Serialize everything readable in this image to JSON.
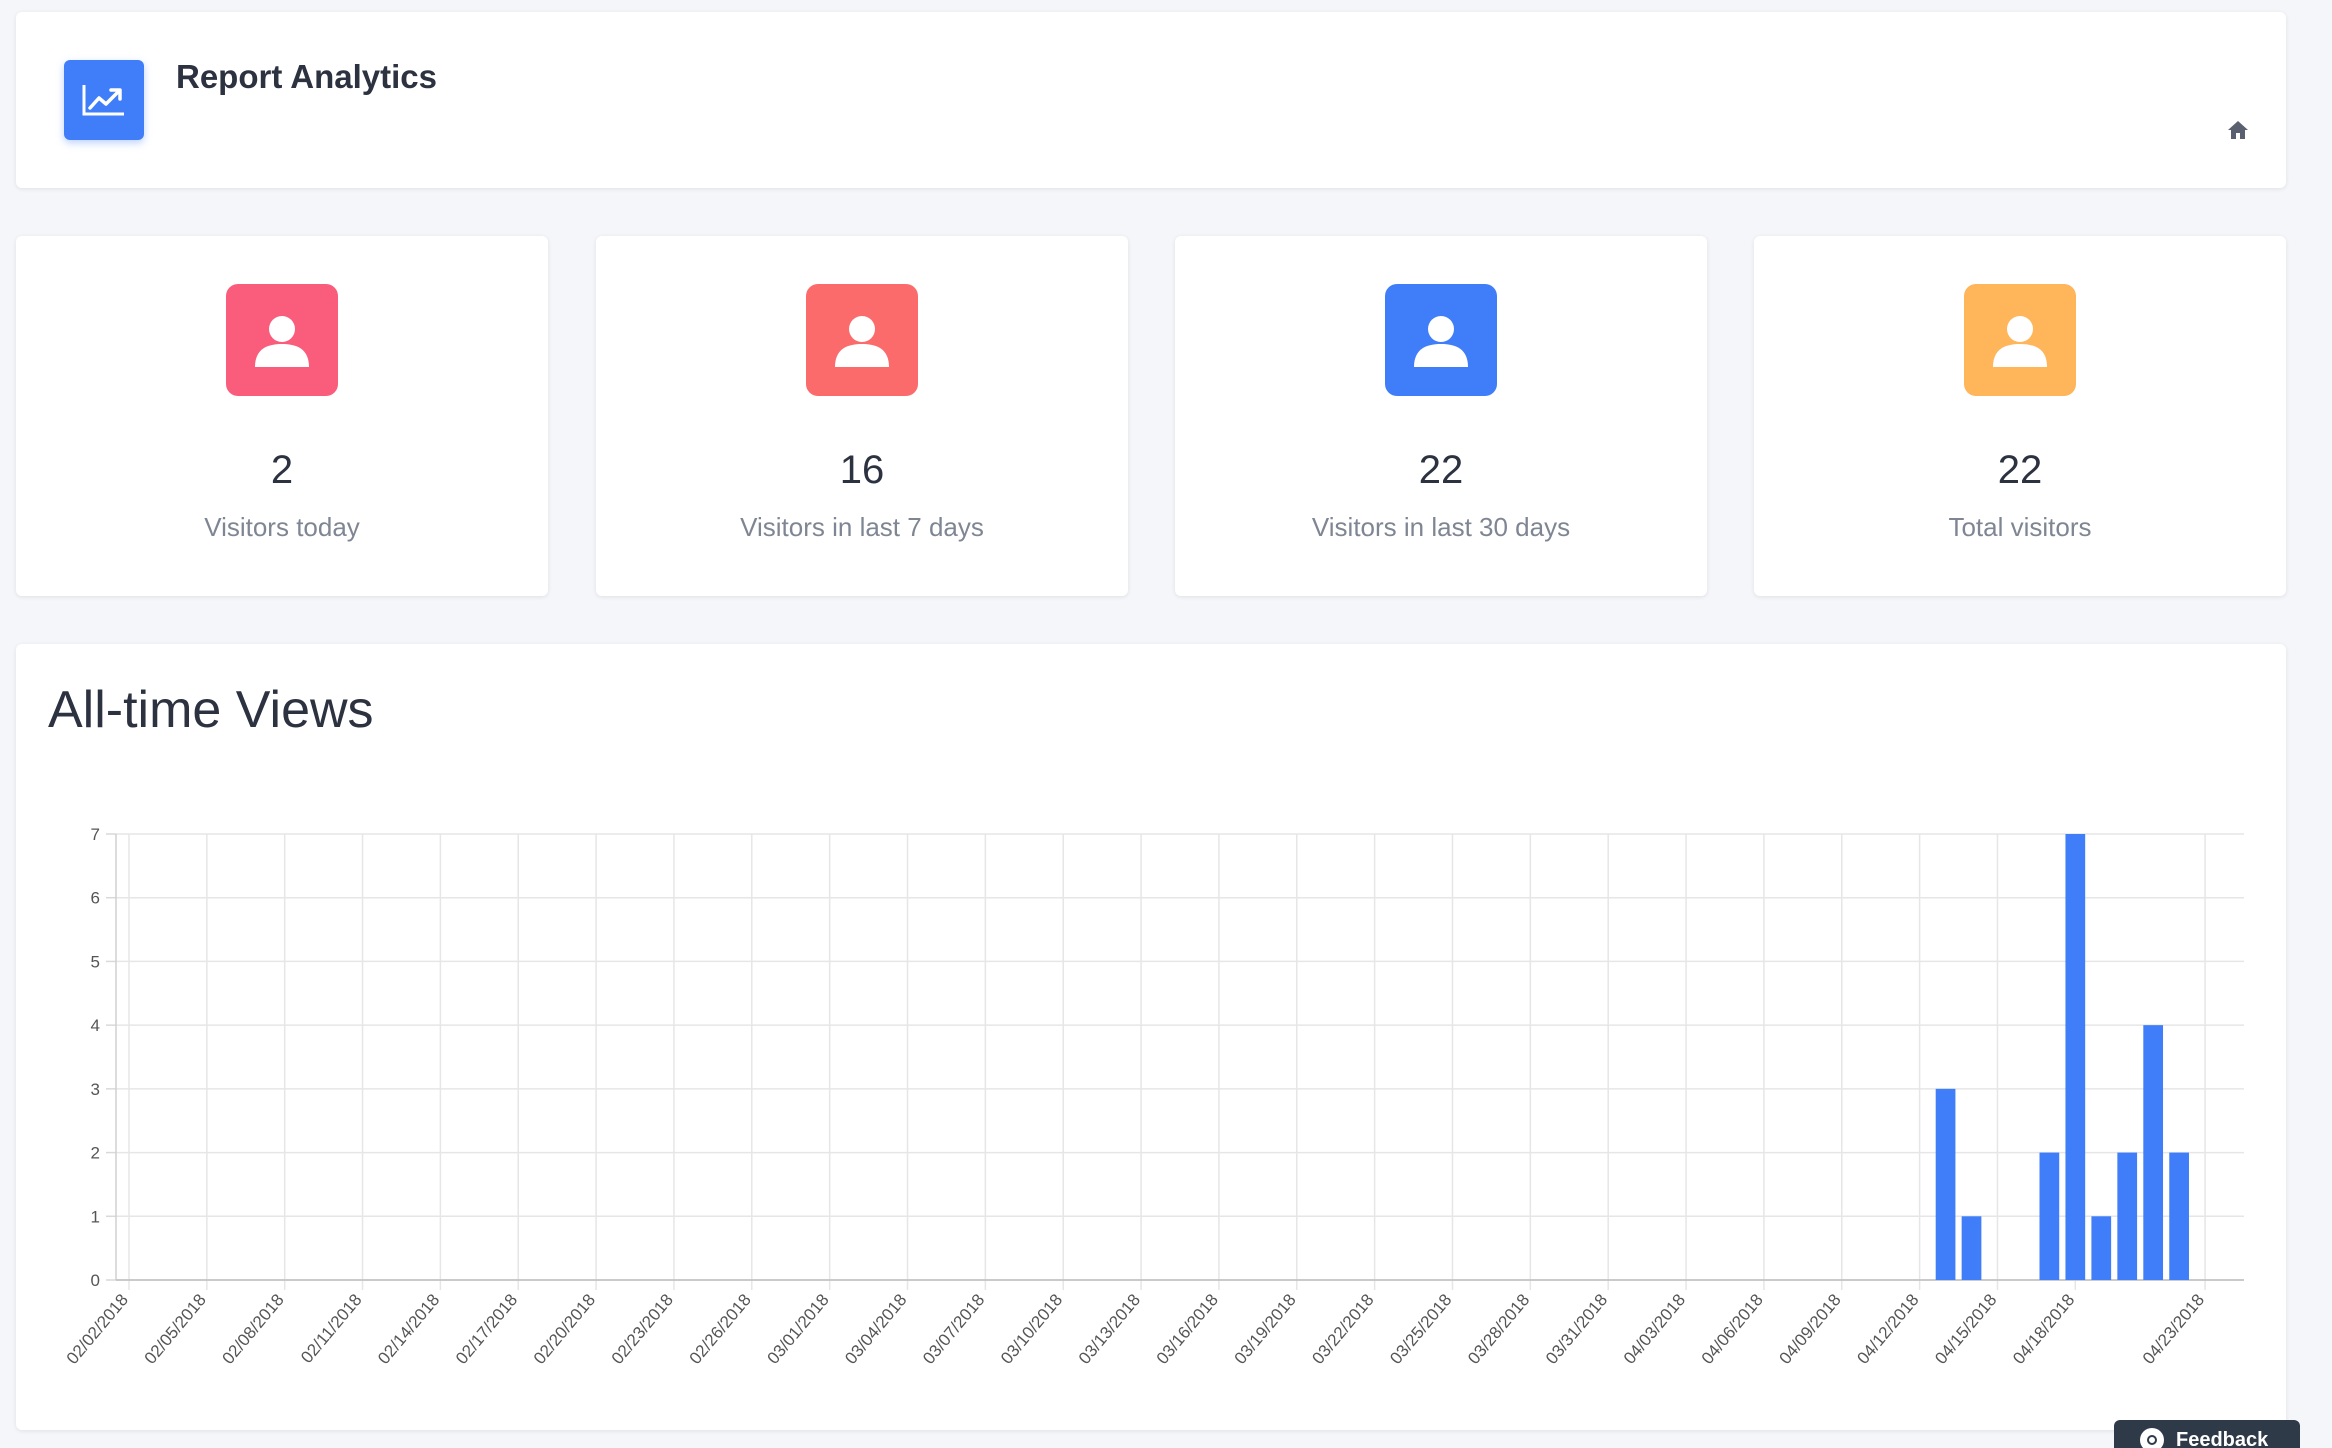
{
  "header": {
    "title": "Report Analytics",
    "icon": "chart-line-icon",
    "icon_color": "#3f7ef8",
    "home_icon": "home-icon"
  },
  "stats": [
    {
      "value": "2",
      "label": "Visitors today",
      "icon": "user-icon",
      "color": "#fa5c7c"
    },
    {
      "value": "16",
      "label": "Visitors in last 7 days",
      "icon": "user-icon",
      "color": "#fb6b6b"
    },
    {
      "value": "22",
      "label": "Visitors in last 30 days",
      "icon": "user-icon",
      "color": "#3f7ef8"
    },
    {
      "value": "22",
      "label": "Total visitors",
      "icon": "user-icon",
      "color": "#ffb55a"
    }
  ],
  "chart": {
    "title": "All-time Views"
  },
  "chart_data": {
    "type": "bar",
    "title": "All-time Views",
    "xlabel": "",
    "ylabel": "",
    "ylim": [
      0,
      7
    ],
    "yticks": [
      0,
      1,
      2,
      3,
      4,
      5,
      6,
      7
    ],
    "grid": true,
    "legend": "none",
    "bar_color": "#3f7ef8",
    "x_start": "02/02/2018",
    "x_end": "04/24/2018",
    "xticks": [
      "02/02/2018",
      "02/05/2018",
      "02/08/2018",
      "02/11/2018",
      "02/14/2018",
      "02/17/2018",
      "02/20/2018",
      "02/23/2018",
      "02/26/2018",
      "03/01/2018",
      "03/04/2018",
      "03/07/2018",
      "03/10/2018",
      "03/13/2018",
      "03/16/2018",
      "03/19/2018",
      "03/22/2018",
      "03/25/2018",
      "03/28/2018",
      "03/31/2018",
      "04/03/2018",
      "04/06/2018",
      "04/09/2018",
      "04/12/2018",
      "04/15/2018",
      "04/18/2018",
      "04/23/2018"
    ],
    "series": [
      {
        "x": [
          "04/13/2018",
          "04/14/2018",
          "04/17/2018",
          "04/18/2018",
          "04/19/2018",
          "04/20/2018",
          "04/21/2018",
          "04/22/2018"
        ],
        "values": [
          3,
          1,
          2,
          7,
          1,
          2,
          4,
          2
        ]
      }
    ]
  },
  "feedback": {
    "label": "Feedback",
    "icon": "camera-icon"
  }
}
